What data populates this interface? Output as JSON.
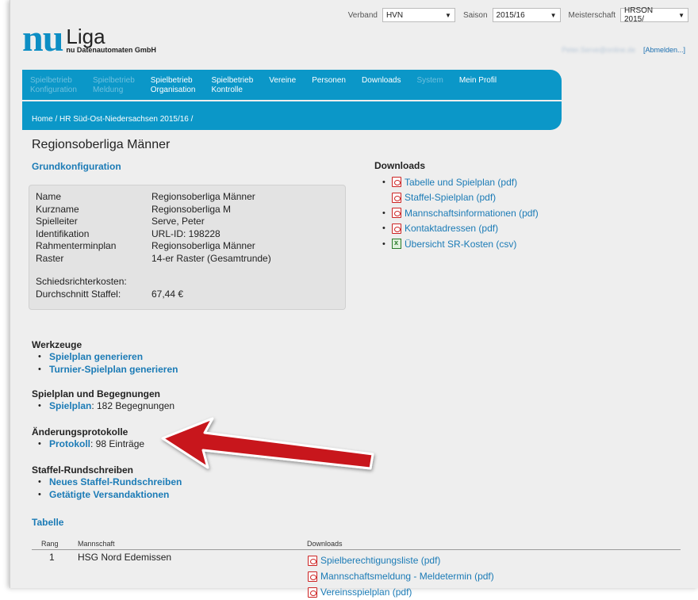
{
  "topbar": {
    "verband_label": "Verband",
    "verband_value": "HVN",
    "saison_label": "Saison",
    "saison_value": "2015/16",
    "meisterschaft_label": "Meisterschaft",
    "meisterschaft_value": "HRSON 2015/"
  },
  "logo": {
    "nu": "nu",
    "liga": "Liga",
    "company": "nu Datenautomaten GmbH"
  },
  "user": {
    "email": "Peter.Serve@online.de",
    "logout": "[Abmelden...]"
  },
  "nav": [
    {
      "line1": "Spielbetrieb",
      "line2": "Konfiguration",
      "dim": true
    },
    {
      "line1": "Spielbetrieb",
      "line2": "Meldung",
      "dim": true
    },
    {
      "line1": "Spielbetrieb",
      "line2": "Organisation",
      "dim": false
    },
    {
      "line1": "Spielbetrieb",
      "line2": "Kontrolle",
      "dim": false
    },
    {
      "line1": "Vereine",
      "line2": "",
      "dim": false
    },
    {
      "line1": "Personen",
      "line2": "",
      "dim": false
    },
    {
      "line1": "Downloads",
      "line2": "",
      "dim": false
    },
    {
      "line1": "System",
      "line2": "",
      "dim": true
    },
    {
      "line1": "Mein Profil",
      "line2": "",
      "dim": false
    }
  ],
  "breadcrumb": "Home / HR Süd-Ost-Niedersachsen 2015/16 /",
  "page_title": "Regionsoberliga Männer",
  "grundkonfiguration": {
    "title": "Grundkonfiguration",
    "rows": [
      {
        "key": "Name",
        "value": "Regionsoberliga Männer"
      },
      {
        "key": "Kurzname",
        "value": "Regionsoberliga M"
      },
      {
        "key": "Spielleiter",
        "value": "Serve, Peter"
      },
      {
        "key": "Identifikation",
        "value": "URL-ID: 198228"
      },
      {
        "key": "Rahmenterminplan",
        "value": "Regionsoberliga Männer"
      },
      {
        "key": "Raster",
        "value": "14-er Raster (Gesamtrunde)"
      }
    ],
    "kosten_label": "Schiedsrichterkosten:",
    "durchschnitt_label": "Durchschnitt Staffel:",
    "durchschnitt_value": "67,44 €"
  },
  "downloads": {
    "title": "Downloads",
    "items": [
      {
        "label": "Tabelle und Spielplan (pdf)",
        "icon": "pdf-icon",
        "bullet": true
      },
      {
        "label": "Staffel-Spielplan (pdf)",
        "icon": "pdf-icon",
        "bullet": false
      },
      {
        "label": "Mannschaftsinformationen (pdf)",
        "icon": "pdf-icon",
        "bullet": true
      },
      {
        "label": "Kontaktadressen (pdf)",
        "icon": "pdf-icon",
        "bullet": true
      },
      {
        "label": "Übersicht SR-Kosten (csv)",
        "icon": "spreadsheet-icon",
        "bullet": true
      }
    ]
  },
  "werkzeuge": {
    "title": "Werkzeuge",
    "items": [
      "Spielplan generieren",
      "Turnier-Spielplan generieren"
    ]
  },
  "spielplan": {
    "title": "Spielplan und Begegnungen",
    "link": "Spielplan",
    "suffix": ": 182 Begegnungen"
  },
  "protokoll": {
    "title": "Änderungsprotokolle",
    "link": "Protokoll",
    "suffix": ": 98 Einträge"
  },
  "rundschreiben": {
    "title": "Staffel-Rundschreiben",
    "items": [
      "Neues Staffel-Rundschreiben",
      "Getätigte Versandaktionen"
    ]
  },
  "tabelle": {
    "title": "Tabelle",
    "col_rang": "Rang",
    "col_mannschaft": "Mannschaft",
    "col_downloads": "Downloads",
    "row": {
      "rang": "1",
      "mannschaft": "HSG Nord Edemissen"
    },
    "row_downloads": [
      "Spielberechtigungsliste (pdf)",
      "Mannschaftsmeldung - Meldetermin (pdf)",
      "Vereinsspielplan (pdf)"
    ]
  },
  "colors": {
    "accent": "#0b97c8",
    "link": "#1b7bb6",
    "arrow": "#c8121a"
  }
}
